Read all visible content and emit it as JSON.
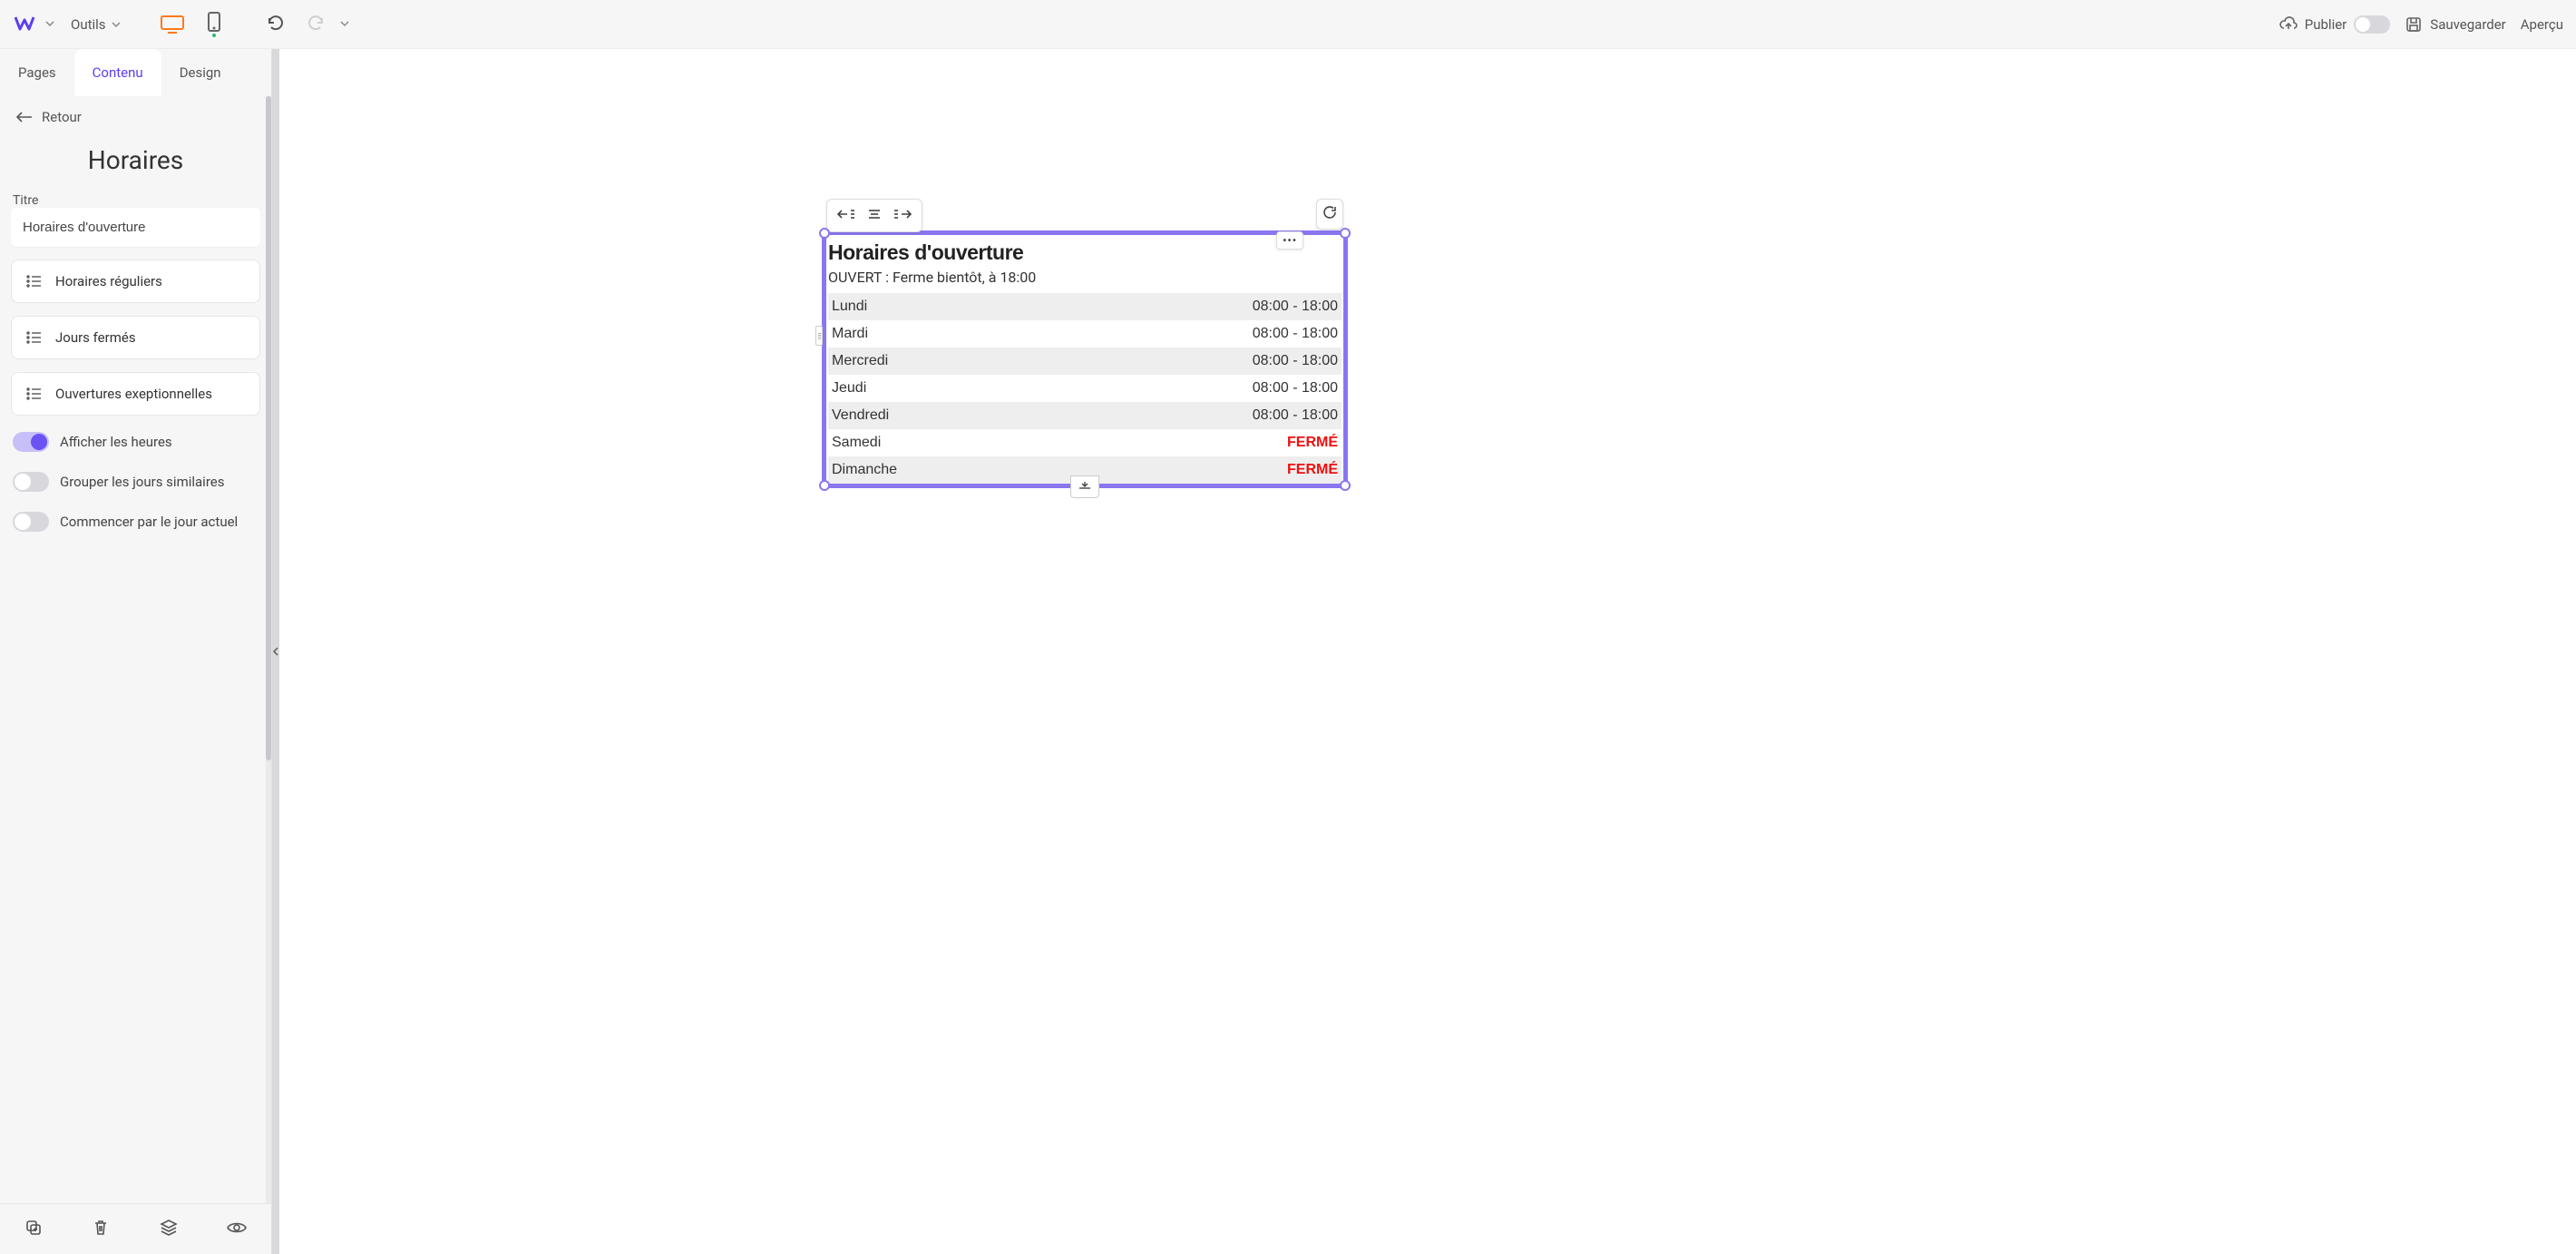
{
  "topbar": {
    "tools_label": "Outils",
    "publish_label": "Publier",
    "save_label": "Sauvegarder",
    "preview_label": "Aperçu"
  },
  "tabs": {
    "pages": "Pages",
    "contenu": "Contenu",
    "design": "Design"
  },
  "panel": {
    "back": "Retour",
    "title": "Horaires",
    "titre_label": "Titre",
    "titre_value": "Horaires d'ouverture",
    "card_regular": "Horaires réguliers",
    "card_closed": "Jours fermés",
    "card_exceptional": "Ouvertures exeptionnelles",
    "toggle_show_hours": "Afficher les heures",
    "toggle_group": "Grouper les jours similaires",
    "toggle_start_today": "Commencer par le jour actuel"
  },
  "widget": {
    "heading": "Horaires d'ouverture",
    "status": "OUVERT : Ferme bientôt, à 18:00",
    "closed_label": "FERMÉ",
    "rows": [
      {
        "day": "Lundi",
        "hours": "08:00 - 18:00",
        "closed": false
      },
      {
        "day": "Mardi",
        "hours": "08:00 - 18:00",
        "closed": false
      },
      {
        "day": "Mercredi",
        "hours": "08:00 - 18:00",
        "closed": false
      },
      {
        "day": "Jeudi",
        "hours": "08:00 - 18:00",
        "closed": false
      },
      {
        "day": "Vendredi",
        "hours": "08:00 - 18:00",
        "closed": false
      },
      {
        "day": "Samedi",
        "hours": "",
        "closed": true
      },
      {
        "day": "Dimanche",
        "hours": "",
        "closed": true
      }
    ]
  }
}
